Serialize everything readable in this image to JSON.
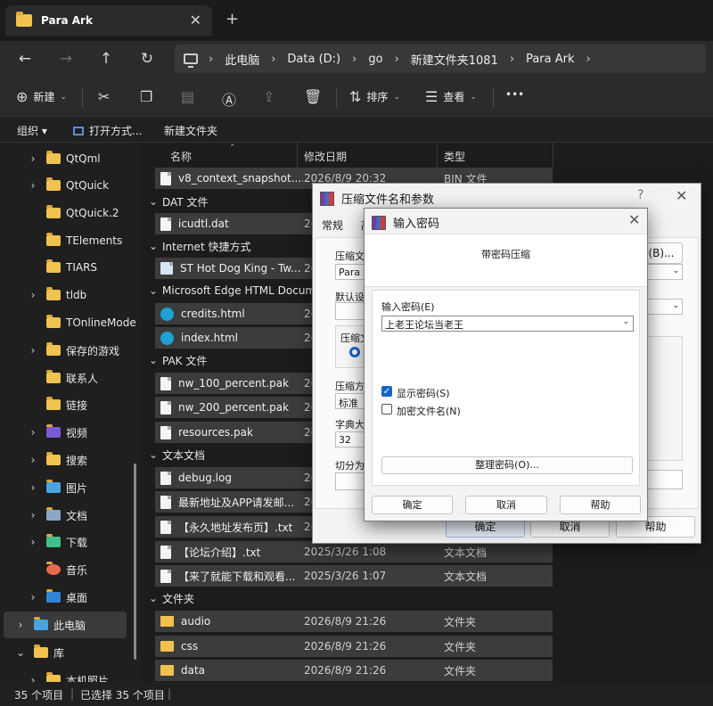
{
  "window": {
    "tab_title": "Para Ark",
    "tab_close": "✕",
    "new_tab": "+"
  },
  "nav": {
    "back": "←",
    "forward": "→",
    "up": "↑",
    "refresh": "↻",
    "breadcrumbs": [
      "此电脑",
      "Data (D:)",
      "go",
      "新建文件夹1081",
      "Para Ark"
    ]
  },
  "toolbar": {
    "new_label": "新建",
    "sort_label": "排序",
    "view_label": "查看",
    "more": "•••"
  },
  "subbar": {
    "organize": "组织",
    "open_with": "打开方式...",
    "new_folder": "新建文件夹"
  },
  "sidebar": {
    "items": [
      {
        "label": "QtQml",
        "chevron": true
      },
      {
        "label": "QtQuick",
        "chevron": true
      },
      {
        "label": "QtQuick.2",
        "chevron": false
      },
      {
        "label": "TElements",
        "chevron": false
      },
      {
        "label": "TIARS",
        "chevron": false
      },
      {
        "label": "tldb",
        "chevron": true
      },
      {
        "label": "TOnlineMode",
        "chevron": false
      },
      {
        "label": "保存的游戏",
        "chevron": true
      },
      {
        "label": "联系人",
        "chevron": false
      },
      {
        "label": "链接",
        "chevron": false
      },
      {
        "label": "视频",
        "chevron": true
      },
      {
        "label": "搜索",
        "chevron": true
      },
      {
        "label": "图片",
        "chevron": true
      },
      {
        "label": "文档",
        "chevron": true
      },
      {
        "label": "下载",
        "chevron": true
      },
      {
        "label": "音乐",
        "chevron": false
      },
      {
        "label": "桌面",
        "chevron": true
      },
      {
        "label": "此电脑",
        "chevron": true
      },
      {
        "label": "库",
        "chevron": true
      },
      {
        "label": "本机照片",
        "chevron": false
      }
    ]
  },
  "columns": {
    "name": "名称",
    "date": "修改日期",
    "type": "类型"
  },
  "groups": {
    "dat": "DAT 文件",
    "internet": "Internet 快捷方式",
    "edge": "Microsoft Edge HTML Document",
    "pak": "PAK 文件",
    "text": "文本文档",
    "folder": "文件夹"
  },
  "files": {
    "v8": {
      "name": "v8_context_snapshot....",
      "date": "2026/8/9 20:32",
      "type": "BIN 文件"
    },
    "icudtl": {
      "name": "icudtl.dat",
      "date": "2(",
      "type": ""
    },
    "hotdog": {
      "name": "ST Hot Dog King - Tw...",
      "date": "2(",
      "type": ""
    },
    "credits": {
      "name": "credits.html",
      "date": "2(",
      "type": ""
    },
    "index": {
      "name": "index.html",
      "date": "2(",
      "type": ""
    },
    "nw100": {
      "name": "nw_100_percent.pak",
      "date": "2(",
      "type": ""
    },
    "nw200": {
      "name": "nw_200_percent.pak",
      "date": "2(",
      "type": ""
    },
    "resources": {
      "name": "resources.pak",
      "date": "2(",
      "type": ""
    },
    "debug": {
      "name": "debug.log",
      "date": "2(",
      "type": ""
    },
    "latest": {
      "name": "最新地址及APP请发邮...",
      "date": "2(",
      "type": ""
    },
    "permanent": {
      "name": "【永久地址发布页】.txt",
      "date": "2(",
      "type": ""
    },
    "forum": {
      "name": "【论坛介绍】.txt",
      "date": "2025/3/26 1:08",
      "type": "文本文档"
    },
    "comehere": {
      "name": "【来了就能下载和观看...",
      "date": "2025/3/26 1:07",
      "type": "文本文档"
    },
    "audio": {
      "name": "audio",
      "date": "2026/8/9 21:26",
      "type": "文件夹"
    },
    "css": {
      "name": "css",
      "date": "2026/8/9 21:26",
      "type": "文件夹"
    },
    "data": {
      "name": "data",
      "date": "2026/8/9 21:26",
      "type": "文件夹"
    }
  },
  "status": {
    "count": "35 个项目",
    "selected": "已选择 35 个项目"
  },
  "dialog_archive": {
    "title": "压缩文件名和参数",
    "help_glyph": "?",
    "close_glyph": "✕",
    "tab_general": "常规",
    "tab_adv": "高",
    "archive_name_label": "压缩文",
    "archive_name_value": "Para Ar",
    "browse": "(B)...",
    "default_settings_label": "默认设置",
    "format_label": "压缩文",
    "method_label": "压缩方",
    "method_value": "标准",
    "dict_label": "字典大小",
    "dict_value": "32",
    "split_label": "切分为分",
    "ok": "确定",
    "cancel": "取消",
    "help": "帮助"
  },
  "dialog_password": {
    "title": "输入密码",
    "close_glyph": "✕",
    "heading": "带密码压缩",
    "enter_label": "输入密码(E)",
    "password_value": "上老王论坛当老王",
    "show_password": "显示密码(S)",
    "encrypt_names": "加密文件名(N)",
    "organize": "整理密码(O)...",
    "ok": "确定",
    "cancel": "取消",
    "help": "帮助"
  }
}
